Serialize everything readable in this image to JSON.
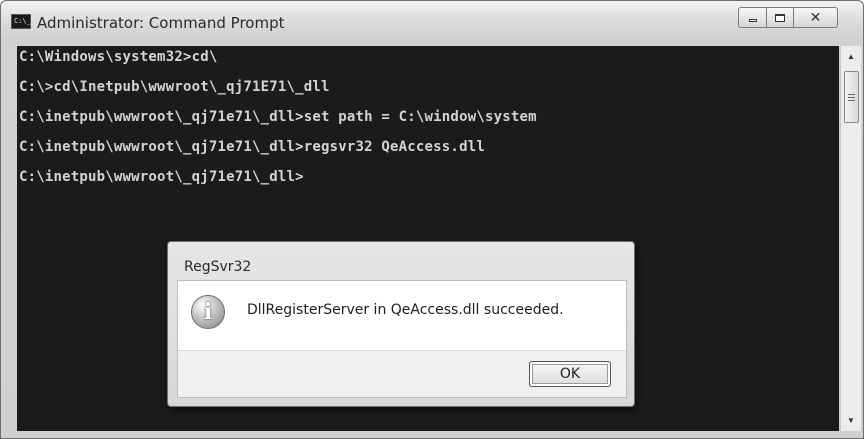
{
  "window": {
    "title": "Administrator: Command Prompt",
    "icon_text": "C:\\_"
  },
  "console": {
    "lines": [
      "C:\\Windows\\system32>cd\\",
      "C:\\>cd\\Inetpub\\wwwroot\\_qj71E71\\_dll",
      "C:\\inetpub\\wwwroot\\_qj71e71\\_dll>set path = C:\\window\\system",
      "C:\\inetpub\\wwwroot\\_qj71e71\\_dll>regsvr32 QeAccess.dll",
      "C:\\inetpub\\wwwroot\\_qj71e71\\_dll>"
    ]
  },
  "dialog": {
    "title": "RegSvr32",
    "message": "DllRegisterServer in QeAccess.dll succeeded.",
    "ok_label": "OK",
    "icon": "info-icon"
  },
  "caption_buttons": {
    "close_glyph": "✕"
  },
  "scrollbar": {
    "up_glyph": "▲",
    "down_glyph": "▼"
  },
  "colors": {
    "console_bg": "#1b1b1b",
    "console_text": "#d4d4d4"
  }
}
